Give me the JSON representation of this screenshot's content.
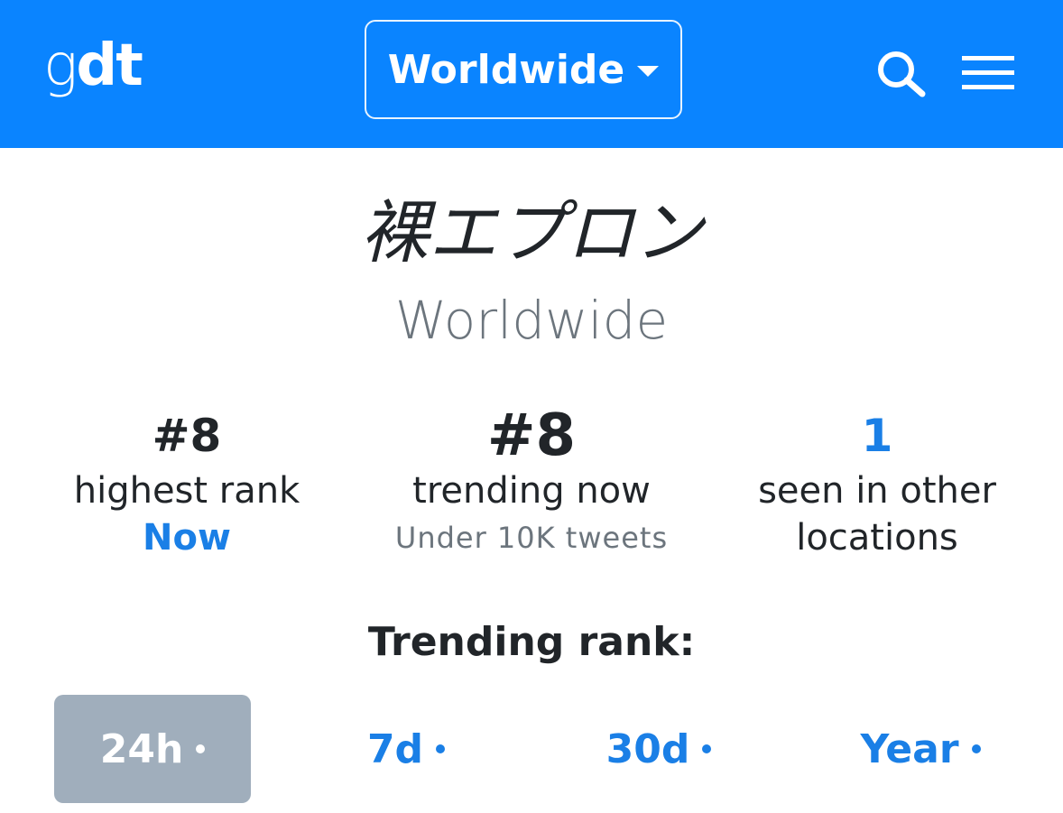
{
  "header": {
    "logo_g": "g",
    "logo_dt": "dt",
    "location_label": "Worldwide",
    "brand_color": "#0a84ff",
    "icons": [
      "search-icon",
      "menu-icon",
      "caret-down-icon"
    ]
  },
  "trend": {
    "title": "裸エプロン",
    "location": "Worldwide"
  },
  "stats": {
    "highest_rank": {
      "value": "#8",
      "label": "highest rank",
      "when": "Now"
    },
    "trending_now": {
      "value": "#8",
      "label": "trending now",
      "volume": "Under 10K tweets"
    },
    "other_locations": {
      "value": "1",
      "label_line1": "seen in other",
      "label_line2": "locations"
    }
  },
  "trending_rank": {
    "heading": "Trending rank:",
    "tabs": [
      {
        "label": "24h",
        "active": true
      },
      {
        "label": "7d",
        "active": false
      },
      {
        "label": "30d",
        "active": false
      },
      {
        "label": "Year",
        "active": false
      }
    ]
  }
}
